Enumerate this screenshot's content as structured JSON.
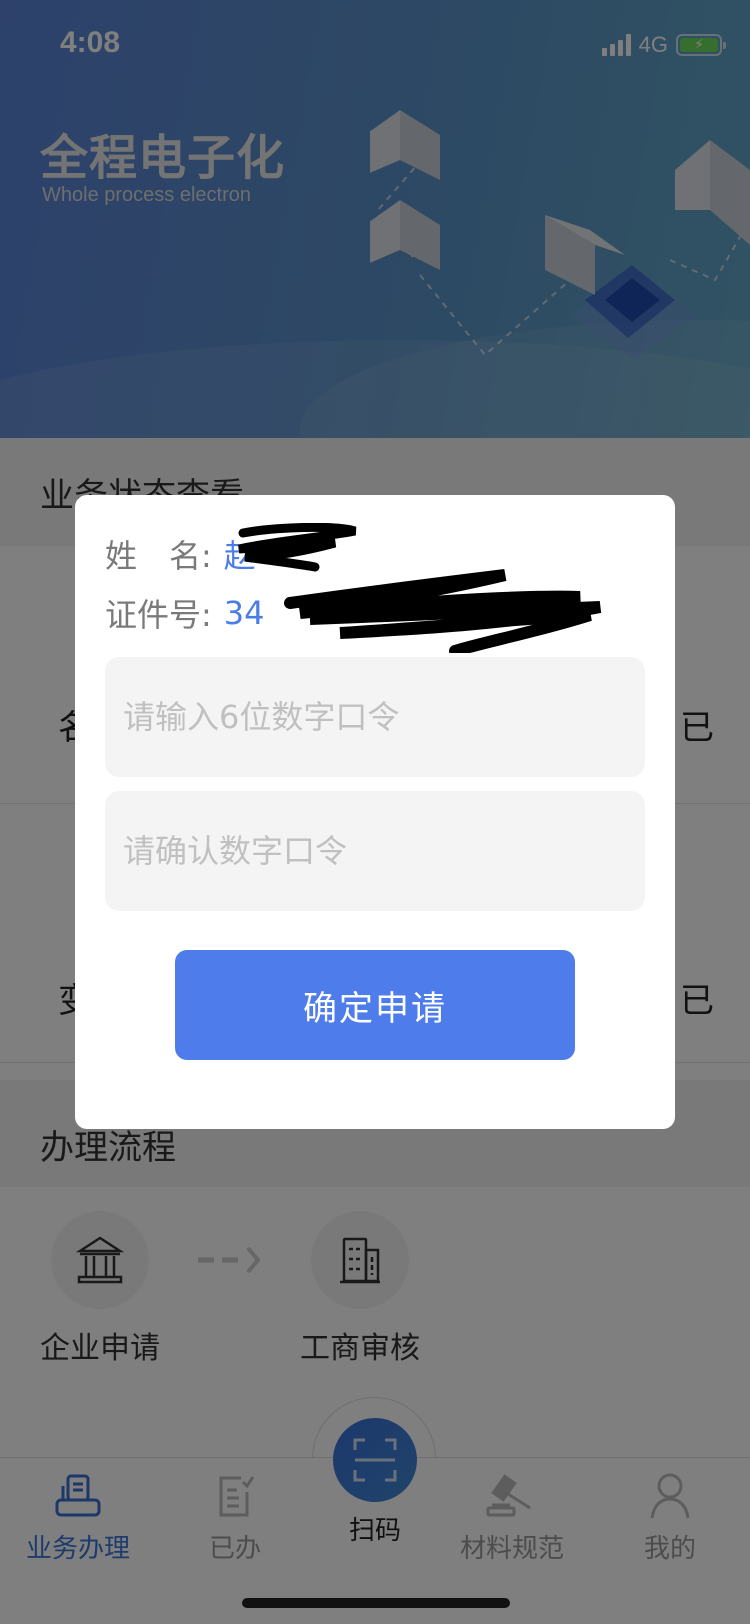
{
  "status_bar": {
    "time": "4:08",
    "network": "4G",
    "battery_state": "charging",
    "icons": [
      "signal-icon",
      "battery-charging-icon"
    ]
  },
  "banner": {
    "title": "全程电子化",
    "subtitle": "Whole process electron"
  },
  "sections": {
    "status_title": "业务状态查看",
    "status_rows": [
      {
        "left_partial": "名",
        "right_partial": "已"
      },
      {
        "left_partial": "变",
        "right_partial": "已"
      }
    ],
    "process_title": "办理流程",
    "process_steps": [
      {
        "label": "企业申请",
        "icon": "bank-building-icon"
      },
      {
        "label": "工商审核",
        "icon": "office-building-icon"
      }
    ]
  },
  "modal": {
    "name_label": "姓　名:",
    "name_value": "赵",
    "id_label": "证件号:",
    "id_value": "34",
    "password_input": {
      "value": "",
      "placeholder": "请输入6位数字口令"
    },
    "confirm_input": {
      "value": "",
      "placeholder": "请确认数字口令"
    },
    "submit_label": "确定申请"
  },
  "tabbar": {
    "items": [
      {
        "label": "业务办理",
        "icon": "business-fax-icon",
        "active": true
      },
      {
        "label": "已办",
        "icon": "done-checklist-icon",
        "active": false
      },
      {
        "label": "扫码",
        "icon": "scan-icon",
        "active": false
      },
      {
        "label": "材料规范",
        "icon": "gavel-icon",
        "active": false
      },
      {
        "label": "我的",
        "icon": "user-icon",
        "active": false
      }
    ]
  },
  "colors": {
    "accent": "#4e7deb",
    "active_tab": "#3b78d8",
    "value_text": "#4a7ee6"
  }
}
